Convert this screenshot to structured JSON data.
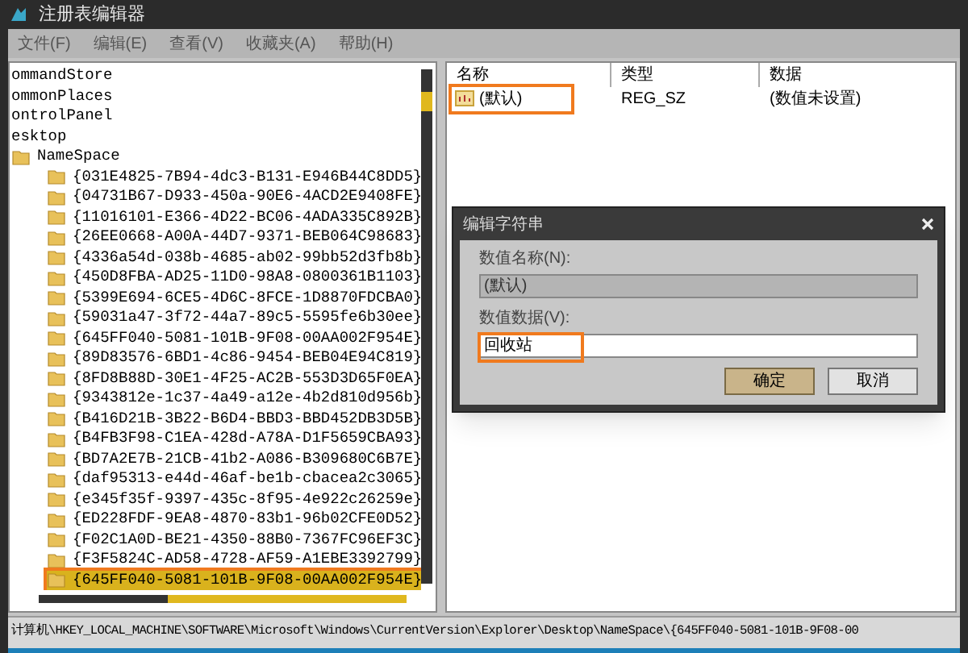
{
  "window": {
    "title": "注册表编辑器"
  },
  "menu": [
    "文件(F)",
    "编辑(E)",
    "查看(V)",
    "收藏夹(A)",
    "帮助(H)"
  ],
  "tree": [
    {
      "label": "ommandStore",
      "selected": false
    },
    {
      "label": "ommonPlaces",
      "selected": false
    },
    {
      "label": "ontrolPanel",
      "selected": false
    },
    {
      "label": "esktop",
      "selected": false
    },
    {
      "label": "NameSpace",
      "selected": false,
      "children": [
        {
          "label": "{031E4825-7B94-4dc3-B131-E946B44C8DD5}",
          "selected": false
        },
        {
          "label": "{04731B67-D933-450a-90E6-4ACD2E9408FE}",
          "selected": false
        },
        {
          "label": "{11016101-E366-4D22-BC06-4ADA335C892B}",
          "selected": false
        },
        {
          "label": "{26EE0668-A00A-44D7-9371-BEB064C98683}",
          "selected": false
        },
        {
          "label": "{4336a54d-038b-4685-ab02-99bb52d3fb8b}",
          "selected": false
        },
        {
          "label": "{450D8FBA-AD25-11D0-98A8-0800361B1103}",
          "selected": false
        },
        {
          "label": "{5399E694-6CE5-4D6C-8FCE-1D8870FDCBA0}",
          "selected": false
        },
        {
          "label": "{59031a47-3f72-44a7-89c5-5595fe6b30ee}",
          "selected": false
        },
        {
          "label": "{645FF040-5081-101B-9F08-00AA002F954E}",
          "selected": false
        },
        {
          "label": "{89D83576-6BD1-4c86-9454-BEB04E94C819}",
          "selected": false
        },
        {
          "label": "{8FD8B88D-30E1-4F25-AC2B-553D3D65F0EA}",
          "selected": false
        },
        {
          "label": "{9343812e-1c37-4a49-a12e-4b2d810d956b}",
          "selected": false
        },
        {
          "label": "{B416D21B-3B22-B6D4-BBD3-BBD452DB3D5B}",
          "selected": false
        },
        {
          "label": "{B4FB3F98-C1EA-428d-A78A-D1F5659CBA93}",
          "selected": false
        },
        {
          "label": "{BD7A2E7B-21CB-41b2-A086-B309680C6B7E}",
          "selected": false
        },
        {
          "label": "{daf95313-e44d-46af-be1b-cbacea2c3065}",
          "selected": false
        },
        {
          "label": "{e345f35f-9397-435c-8f95-4e922c26259e}",
          "selected": false
        },
        {
          "label": "{ED228FDF-9EA8-4870-83b1-96b02CFE0D52}",
          "selected": false
        },
        {
          "label": "{F02C1A0D-BE21-4350-88B0-7367FC96EF3C}",
          "selected": false
        },
        {
          "label": "{F3F5824C-AD58-4728-AF59-A1EBE3392799}",
          "selected": false
        },
        {
          "label": "{645FF040-5081-101B-9F08-00AA002F954E}",
          "selected": true
        }
      ]
    }
  ],
  "values": {
    "columns": [
      "名称",
      "类型",
      "数据"
    ],
    "rows": [
      {
        "name": "(默认)",
        "type": "REG_SZ",
        "data": "(数值未设置)",
        "highlighted": true
      }
    ]
  },
  "dialog": {
    "title": "编辑字符串",
    "name_label": "数值名称(N):",
    "name_value": "(默认)",
    "data_label": "数值数据(V):",
    "data_value": "回收站",
    "data_highlighted": true,
    "buttons": [
      {
        "label": "确定",
        "default": true
      },
      {
        "label": "取消",
        "default": false
      }
    ]
  },
  "status_bar": "计算机\\HKEY_LOCAL_MACHINE\\SOFTWARE\\Microsoft\\Windows\\CurrentVersion\\Explorer\\Desktop\\NameSpace\\{645FF040-5081-101B-9F08-00"
}
